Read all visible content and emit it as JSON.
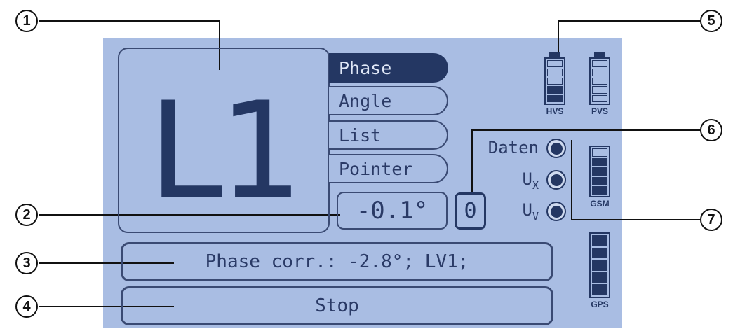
{
  "phase_display": {
    "label": "L1"
  },
  "tabs": [
    {
      "label": "Phase",
      "active": true
    },
    {
      "label": "Angle",
      "active": false
    },
    {
      "label": "List",
      "active": false
    },
    {
      "label": "Pointer",
      "active": false
    }
  ],
  "angle_value": "-0.1°",
  "counter": "0",
  "status_line": "Phase corr.: -2.8°; LV1;",
  "action_button": "Stop",
  "indicators": [
    {
      "label": "Daten"
    },
    {
      "label": "Ux"
    },
    {
      "label": "Uv"
    }
  ],
  "batteries": [
    {
      "label": "HVS",
      "level": 0.4
    },
    {
      "label": "PVS",
      "level": 0
    },
    {
      "label": "GSM",
      "level": 0.8
    },
    {
      "label": "GPS",
      "level": 1
    }
  ],
  "callouts": [
    "1",
    "2",
    "3",
    "4",
    "5",
    "6",
    "7"
  ],
  "colors": {
    "screen_bg": "#a9bde3",
    "ink": "#243763",
    "active_tab": "#243763"
  }
}
